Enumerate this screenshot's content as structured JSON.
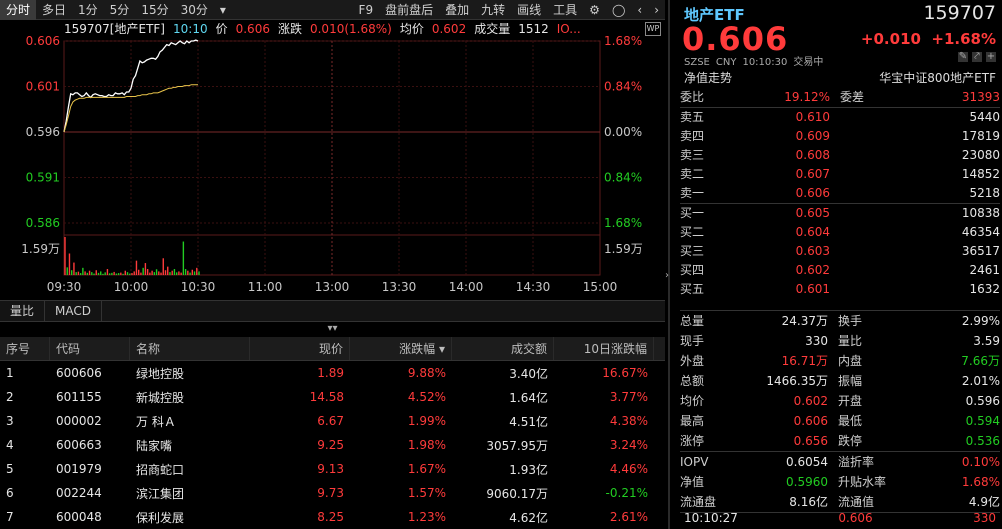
{
  "toolbar": {
    "left_tabs": [
      "分时",
      "多日",
      "1分",
      "5分",
      "15分",
      "30分"
    ],
    "dropdown_arrow": "▾",
    "right_items": [
      "F9",
      "盘前盘后",
      "叠加",
      "九转",
      "画线",
      "工具"
    ],
    "icons": [
      "gear-icon",
      "circle-icon",
      "chevron-left-icon",
      "chevron-right-icon"
    ]
  },
  "info": {
    "code_name": "159707[地产ETF]",
    "time": "10:10",
    "price_label": "价",
    "price": "0.606",
    "change_label": "涨跌",
    "change": "0.010(1.68%)",
    "avg_label": "均价",
    "avg": "0.602",
    "vol_label": "成交量",
    "vol": "1512",
    "iopv_trunc": "IO...",
    "wp_badge": "WP"
  },
  "chart_data": {
    "type": "line",
    "title": "159707[地产ETF] 分时",
    "y_left_ticks": [
      "0.606",
      "0.601",
      "0.596",
      "0.591",
      "0.586"
    ],
    "y_right_ticks": [
      "1.68%",
      "0.84%",
      "0.00%",
      "0.84%",
      "1.68%"
    ],
    "vol_tick": "1.59万",
    "x_ticks": [
      "09:30",
      "10:00",
      "10:30",
      "11:00",
      "13:00",
      "13:30",
      "14:00",
      "14:30",
      "15:00"
    ],
    "ylim": [
      0.586,
      0.606
    ],
    "prev_close": 0.596,
    "series": [
      {
        "name": "价",
        "values": [
          0.596,
          0.5972,
          0.5988,
          0.6002,
          0.6001,
          0.6003,
          0.6003,
          0.6001,
          0.5999,
          0.6,
          0.6003,
          0.6,
          0.5998,
          0.6001,
          0.6002,
          0.6001,
          0.6,
          0.6,
          0.5999,
          0.5999,
          0.6001,
          0.6,
          0.6,
          0.6003,
          0.6002,
          0.6002,
          0.6003,
          0.6001,
          0.6004,
          0.6004,
          0.6008,
          0.6018,
          0.6022,
          0.603,
          0.6038,
          0.6036,
          0.6037,
          0.6039,
          0.604,
          0.6041,
          0.6041,
          0.604,
          0.6043,
          0.6048,
          0.605,
          0.6053,
          0.6056,
          0.6055,
          0.6058,
          0.6057,
          0.6056,
          0.6058,
          0.606,
          0.6058,
          0.6057,
          0.606,
          0.6058,
          0.606,
          0.606,
          0.6061,
          0.606
        ],
        "color": "#ffffff"
      },
      {
        "name": "均价",
        "values": [
          0.596,
          0.5968,
          0.5978,
          0.5988,
          0.5993,
          0.5995,
          0.5996,
          0.5997,
          0.5997,
          0.5997,
          0.5998,
          0.5998,
          0.5998,
          0.5998,
          0.5998,
          0.5998,
          0.5998,
          0.5998,
          0.5998,
          0.5998,
          0.5998,
          0.5998,
          0.5998,
          0.5998,
          0.5998,
          0.5998,
          0.5998,
          0.5998,
          0.5999,
          0.5999,
          0.5999,
          0.5999,
          0.5999,
          0.6,
          0.6,
          0.6001,
          0.6001,
          0.6001,
          0.6002,
          0.6002,
          0.6003,
          0.6003,
          0.6003,
          0.6004,
          0.6005,
          0.6006,
          0.6007,
          0.6008,
          0.6008,
          0.6009,
          0.6009,
          0.601,
          0.601,
          0.601,
          0.6011,
          0.6011,
          0.6011,
          0.6012,
          0.6012,
          0.6012,
          0.6012
        ],
        "color": "#e8c34a"
      }
    ],
    "volume": [
      15900,
      3200,
      9000,
      2000,
      5200,
      1200,
      1400,
      800,
      3000,
      1500,
      900,
      1800,
      1200,
      600,
      2000,
      900,
      1500,
      500,
      1100,
      2500,
      700,
      900,
      1300,
      600,
      800,
      1000,
      500,
      1800,
      1200,
      600,
      800,
      1500,
      6000,
      2200,
      1000,
      3000,
      5000,
      2500,
      1000,
      1800,
      1200,
      2400,
      1500,
      1000,
      7000,
      2000,
      3500,
      1200,
      1800,
      2500,
      1100,
      1500,
      1000,
      14000,
      2500,
      1800,
      1000,
      2200,
      1500,
      3000,
      1512
    ],
    "volume_up": [
      1,
      0,
      1,
      0,
      1,
      0,
      1,
      0,
      0,
      1,
      0,
      1,
      0,
      0,
      1,
      0,
      0,
      0,
      0,
      1,
      0,
      0,
      1,
      0,
      0,
      1,
      0,
      1,
      0,
      0,
      1,
      1,
      1,
      1,
      1,
      0,
      1,
      1,
      1,
      1,
      0,
      0,
      1,
      1,
      1,
      1,
      1,
      0,
      1,
      0,
      0,
      1,
      1,
      0,
      0,
      1,
      0,
      1,
      0,
      1,
      0
    ]
  },
  "subtabs": [
    "量比",
    "MACD"
  ],
  "expander": "▾▾",
  "table": {
    "headers": [
      "序号",
      "代码",
      "名称",
      "现价",
      "涨跌幅 ▾",
      "成交额",
      "10日涨跌幅"
    ],
    "rows": [
      {
        "no": "1",
        "code": "600606",
        "name": "绿地控股",
        "price": "1.89",
        "pct": "9.88%",
        "amount": "3.40亿",
        "pct10": "16.67%",
        "pct10_dir": "up"
      },
      {
        "no": "2",
        "code": "601155",
        "name": "新城控股",
        "price": "14.58",
        "pct": "4.52%",
        "amount": "1.64亿",
        "pct10": "3.77%",
        "pct10_dir": "up"
      },
      {
        "no": "3",
        "code": "000002",
        "name": "万 科Ａ",
        "price": "6.67",
        "pct": "1.99%",
        "amount": "4.51亿",
        "pct10": "4.38%",
        "pct10_dir": "up"
      },
      {
        "no": "4",
        "code": "600663",
        "name": "陆家嘴",
        "price": "9.25",
        "pct": "1.98%",
        "amount": "3057.95万",
        "pct10": "3.24%",
        "pct10_dir": "up"
      },
      {
        "no": "5",
        "code": "001979",
        "name": "招商蛇口",
        "price": "9.13",
        "pct": "1.67%",
        "amount": "1.93亿",
        "pct10": "4.46%",
        "pct10_dir": "up"
      },
      {
        "no": "6",
        "code": "002244",
        "name": "滨江集团",
        "price": "9.73",
        "pct": "1.57%",
        "amount": "9060.17万",
        "pct10": "-0.21%",
        "pct10_dir": "down"
      },
      {
        "no": "7",
        "code": "600048",
        "name": "保利发展",
        "price": "8.25",
        "pct": "1.23%",
        "amount": "4.62亿",
        "pct10": "2.61%",
        "pct10_dir": "up"
      }
    ]
  },
  "quote": {
    "name": "地产ETF",
    "code": "159707",
    "price": "0.606",
    "change": "+0.010",
    "change_pct": "+1.68%",
    "exchange": "SZSE",
    "currency": "CNY",
    "time": "10:10:30",
    "status": "交易中",
    "nav_label": "净值走势",
    "index_name": "华宝中证800地产ETF",
    "wei_bi_label": "委比",
    "wei_bi": "19.12%",
    "wei_cha_label": "委差",
    "wei_cha": "31393",
    "asks": [
      {
        "label": "卖五",
        "price": "0.610",
        "vol": "5440"
      },
      {
        "label": "卖四",
        "price": "0.609",
        "vol": "17819"
      },
      {
        "label": "卖三",
        "price": "0.608",
        "vol": "23080"
      },
      {
        "label": "卖二",
        "price": "0.607",
        "vol": "14852"
      },
      {
        "label": "卖一",
        "price": "0.606",
        "vol": "5218"
      }
    ],
    "bids": [
      {
        "label": "买一",
        "price": "0.605",
        "vol": "10838"
      },
      {
        "label": "买二",
        "price": "0.604",
        "vol": "46354"
      },
      {
        "label": "买三",
        "price": "0.603",
        "vol": "36517"
      },
      {
        "label": "买四",
        "price": "0.602",
        "vol": "2461"
      },
      {
        "label": "买五",
        "price": "0.601",
        "vol": "1632"
      }
    ],
    "stats": [
      {
        "k": "总量",
        "v": "24.37万",
        "vc": "white",
        "k2": "换手",
        "v2": "2.99%",
        "v2c": "white"
      },
      {
        "k": "现手",
        "v": "330",
        "vc": "white",
        "k2": "量比",
        "v2": "3.59",
        "v2c": "white"
      },
      {
        "k": "外盘",
        "v": "16.71万",
        "vc": "red",
        "k2": "内盘",
        "v2": "7.66万",
        "v2c": "green"
      },
      {
        "k": "总额",
        "v": "1466.35万",
        "vc": "white",
        "k2": "振幅",
        "v2": "2.01%",
        "v2c": "white"
      },
      {
        "k": "均价",
        "v": "0.602",
        "vc": "red",
        "k2": "开盘",
        "v2": "0.596",
        "v2c": "white"
      },
      {
        "k": "最高",
        "v": "0.606",
        "vc": "red",
        "k2": "最低",
        "v2": "0.594",
        "v2c": "green"
      },
      {
        "k": "涨停",
        "v": "0.656",
        "vc": "red",
        "k2": "跌停",
        "v2": "0.536",
        "v2c": "green"
      }
    ],
    "stats2": [
      {
        "k": "IOPV",
        "v": "0.6054",
        "vc": "white",
        "k2": "溢折率",
        "v2": "0.10%",
        "v2c": "red"
      },
      {
        "k": "净值",
        "v": "0.5960",
        "vc": "green",
        "k2": "升贴水率",
        "v2": "1.68%",
        "v2c": "red"
      },
      {
        "k": "流通盘",
        "v": "8.16亿",
        "vc": "white",
        "k2": "流通值",
        "v2": "4.9亿",
        "v2c": "white"
      }
    ],
    "tick": {
      "time": "10:10:27",
      "price": "0.606",
      "vol": "330"
    }
  },
  "colors": {
    "up": "#ff3b3b",
    "down": "#22cc22",
    "price_line": "#ffffff",
    "avg_line": "#e8c34a",
    "grid": "#3a1010",
    "accent": "#5fc8ff"
  }
}
